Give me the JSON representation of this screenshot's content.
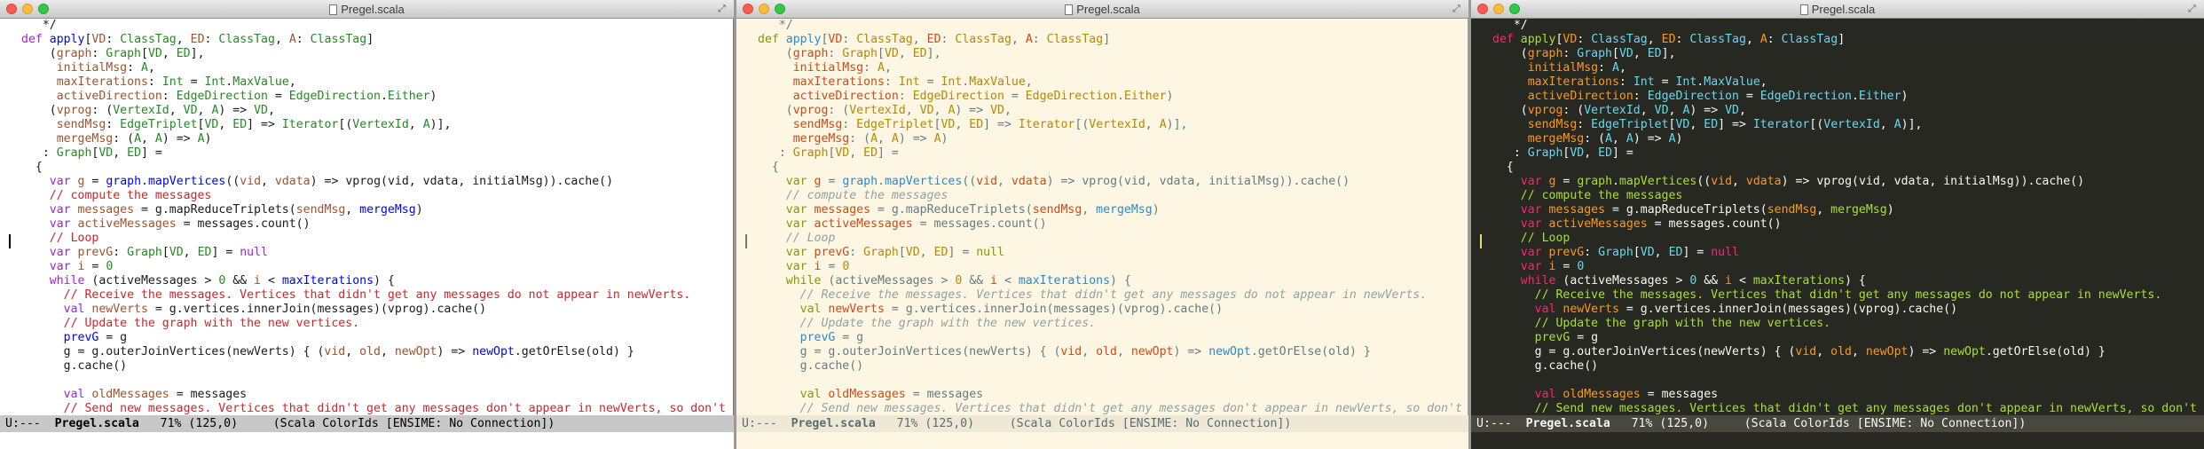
{
  "windows": [
    {
      "title": "Pregel.scala",
      "theme": "light"
    },
    {
      "title": "Pregel.scala",
      "theme": "solarized-light"
    },
    {
      "title": "Pregel.scala",
      "theme": "monokai"
    }
  ],
  "code_lines": [
    [
      [
        "p",
        "   */"
      ]
    ],
    [
      [
        "k",
        "def "
      ],
      [
        "f",
        "apply"
      ],
      [
        "p",
        "["
      ],
      [
        "v",
        "VD"
      ],
      [
        "p",
        ": "
      ],
      [
        "t",
        "ClassTag"
      ],
      [
        "p",
        ", "
      ],
      [
        "v",
        "ED"
      ],
      [
        "p",
        ": "
      ],
      [
        "t",
        "ClassTag"
      ],
      [
        "p",
        ", "
      ],
      [
        "v",
        "A"
      ],
      [
        "p",
        ": "
      ],
      [
        "t",
        "ClassTag"
      ],
      [
        "p",
        "]"
      ]
    ],
    [
      [
        "p",
        "    ("
      ],
      [
        "v",
        "graph"
      ],
      [
        "p",
        ": "
      ],
      [
        "t",
        "Graph"
      ],
      [
        "p",
        "["
      ],
      [
        "t",
        "VD"
      ],
      [
        "p",
        ", "
      ],
      [
        "t",
        "ED"
      ],
      [
        "p",
        "],"
      ]
    ],
    [
      [
        "p",
        "     "
      ],
      [
        "v",
        "initialMsg"
      ],
      [
        "p",
        ": "
      ],
      [
        "t",
        "A"
      ],
      [
        "p",
        ","
      ]
    ],
    [
      [
        "p",
        "     "
      ],
      [
        "v",
        "maxIterations"
      ],
      [
        "p",
        ": "
      ],
      [
        "t",
        "Int"
      ],
      [
        "p",
        " = "
      ],
      [
        "t",
        "Int"
      ],
      [
        "p",
        "."
      ],
      [
        "t",
        "MaxValue"
      ],
      [
        "p",
        ","
      ]
    ],
    [
      [
        "p",
        "     "
      ],
      [
        "v",
        "activeDirection"
      ],
      [
        "p",
        ": "
      ],
      [
        "t",
        "EdgeDirection"
      ],
      [
        "p",
        " = "
      ],
      [
        "t",
        "EdgeDirection"
      ],
      [
        "p",
        "."
      ],
      [
        "t",
        "Either"
      ],
      [
        "p",
        ")"
      ]
    ],
    [
      [
        "p",
        "    ("
      ],
      [
        "v",
        "vprog"
      ],
      [
        "p",
        ": ("
      ],
      [
        "t",
        "VertexId"
      ],
      [
        "p",
        ", "
      ],
      [
        "t",
        "VD"
      ],
      [
        "p",
        ", "
      ],
      [
        "t",
        "A"
      ],
      [
        "p",
        ") => "
      ],
      [
        "t",
        "VD"
      ],
      [
        "p",
        ","
      ]
    ],
    [
      [
        "p",
        "     "
      ],
      [
        "v",
        "sendMsg"
      ],
      [
        "p",
        ": "
      ],
      [
        "t",
        "EdgeTriplet"
      ],
      [
        "p",
        "["
      ],
      [
        "t",
        "VD"
      ],
      [
        "p",
        ", "
      ],
      [
        "t",
        "ED"
      ],
      [
        "p",
        "] => "
      ],
      [
        "t",
        "Iterator"
      ],
      [
        "p",
        "[("
      ],
      [
        "t",
        "VertexId"
      ],
      [
        "p",
        ", "
      ],
      [
        "t",
        "A"
      ],
      [
        "p",
        ")],"
      ]
    ],
    [
      [
        "p",
        "     "
      ],
      [
        "v",
        "mergeMsg"
      ],
      [
        "p",
        ": ("
      ],
      [
        "t",
        "A"
      ],
      [
        "p",
        ", "
      ],
      [
        "t",
        "A"
      ],
      [
        "p",
        ") => "
      ],
      [
        "t",
        "A"
      ],
      [
        "p",
        ")"
      ]
    ],
    [
      [
        "p",
        "   : "
      ],
      [
        "t",
        "Graph"
      ],
      [
        "p",
        "["
      ],
      [
        "t",
        "VD"
      ],
      [
        "p",
        ", "
      ],
      [
        "t",
        "ED"
      ],
      [
        "p",
        "] ="
      ]
    ],
    [
      [
        "p",
        "  {"
      ]
    ],
    [
      [
        "p",
        "    "
      ],
      [
        "k",
        "var "
      ],
      [
        "v",
        "g"
      ],
      [
        "p",
        " = "
      ],
      [
        "f",
        "graph"
      ],
      [
        "p",
        "."
      ],
      [
        "f",
        "mapVertices"
      ],
      [
        "p",
        "(("
      ],
      [
        "v",
        "vid"
      ],
      [
        "p",
        ", "
      ],
      [
        "v",
        "vdata"
      ],
      [
        "p",
        ") => vprog(vid, vdata, initialMsg)).cache()"
      ]
    ],
    [
      [
        "c",
        "    // compute the messages"
      ]
    ],
    [
      [
        "p",
        "    "
      ],
      [
        "k",
        "var "
      ],
      [
        "v",
        "messages"
      ],
      [
        "p",
        " = g.mapReduceTriplets("
      ],
      [
        "v",
        "sendMsg"
      ],
      [
        "p",
        ", "
      ],
      [
        "f",
        "mergeMsg"
      ],
      [
        "p",
        ")"
      ]
    ],
    [
      [
        "p",
        "    "
      ],
      [
        "k",
        "var "
      ],
      [
        "v",
        "activeMessages"
      ],
      [
        "p",
        " = messages.count()"
      ]
    ],
    [
      [
        "c",
        "    // Loop"
      ]
    ],
    [
      [
        "p",
        "    "
      ],
      [
        "k",
        "var "
      ],
      [
        "v",
        "prevG"
      ],
      [
        "p",
        ": "
      ],
      [
        "t",
        "Graph"
      ],
      [
        "p",
        "["
      ],
      [
        "t",
        "VD"
      ],
      [
        "p",
        ", "
      ],
      [
        "t",
        "ED"
      ],
      [
        "p",
        "] = "
      ],
      [
        "k",
        "null"
      ]
    ],
    [
      [
        "p",
        "    "
      ],
      [
        "k",
        "var "
      ],
      [
        "v",
        "i"
      ],
      [
        "p",
        " = "
      ],
      [
        "t",
        "0"
      ]
    ],
    [
      [
        "p",
        "    "
      ],
      [
        "k",
        "while"
      ],
      [
        "p",
        " (activeMessages > "
      ],
      [
        "t",
        "0"
      ],
      [
        "p",
        " && "
      ],
      [
        "v",
        "i"
      ],
      [
        "p",
        " < "
      ],
      [
        "f",
        "maxIterations"
      ],
      [
        "p",
        ") {"
      ]
    ],
    [
      [
        "c",
        "      // Receive the messages. Vertices that didn't get any messages do not appear in newVerts."
      ]
    ],
    [
      [
        "p",
        "      "
      ],
      [
        "k",
        "val "
      ],
      [
        "v",
        "newVerts"
      ],
      [
        "p",
        " = g.vertices.innerJoin(messages)(vprog).cache()"
      ]
    ],
    [
      [
        "c",
        "      // Update the graph with the new vertices."
      ]
    ],
    [
      [
        "p",
        "      "
      ],
      [
        "f",
        "prevG"
      ],
      [
        "p",
        " = g"
      ]
    ],
    [
      [
        "p",
        "      g = g.outerJoinVertices(newVerts) { ("
      ],
      [
        "v",
        "vid"
      ],
      [
        "p",
        ", "
      ],
      [
        "v",
        "old"
      ],
      [
        "p",
        ", "
      ],
      [
        "v",
        "newOpt"
      ],
      [
        "p",
        ") => "
      ],
      [
        "f",
        "newOpt"
      ],
      [
        "p",
        ".getOrElse(old) }"
      ]
    ],
    [
      [
        "p",
        "      g.cache()"
      ]
    ],
    [
      [
        "p",
        ""
      ]
    ],
    [
      [
        "p",
        "      "
      ],
      [
        "k",
        "val "
      ],
      [
        "v",
        "oldMessages"
      ],
      [
        "p",
        " = messages"
      ]
    ],
    [
      [
        "c",
        "      // Send new messages. Vertices that didn't get any messages don't appear in newVerts, so don't"
      ]
    ]
  ],
  "modeline": {
    "status": "U:---  ",
    "buffer": "Pregel.scala",
    "position": "   71% (125,0)     ",
    "modes": "(Scala ColorIds [ENSIME: No Connection])"
  },
  "colors": {
    "light_bg": "#ffffff",
    "solarized_bg": "#fdf6e3",
    "monokai_bg": "#272822"
  }
}
